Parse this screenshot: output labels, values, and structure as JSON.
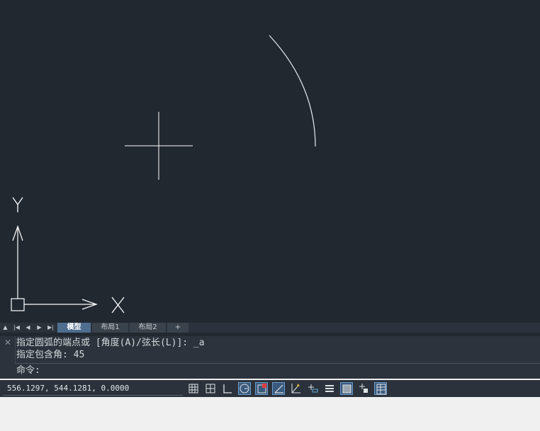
{
  "layout_tabs": {
    "nav_icons": [
      "triangle-up-icon",
      "first-page-icon",
      "prev-icon",
      "next-icon",
      "last-page-icon"
    ],
    "tabs": [
      {
        "label": "模型",
        "active": true
      },
      {
        "label": "布局1",
        "active": false
      },
      {
        "label": "布局2",
        "active": false
      }
    ],
    "add_label": "+"
  },
  "ucs": {
    "x_label": "X",
    "y_label": "Y"
  },
  "command_line": {
    "history": [
      "指定圆弧的端点或 [角度(A)/弦长(L)]: _a",
      "指定包含角: 45"
    ],
    "prompt": "命令:",
    "close_icon": "close-icon"
  },
  "status": {
    "coordinates": "556.1297, 544.1281, 0.0000",
    "toggles": [
      {
        "name": "snap-grid-icon",
        "on": false
      },
      {
        "name": "grid-display-icon",
        "on": false
      },
      {
        "name": "ortho-icon",
        "on": false
      },
      {
        "name": "polar-tracking-icon",
        "on": true
      },
      {
        "name": "object-snap-icon",
        "on": true
      },
      {
        "name": "object-snap-tracking-icon",
        "on": true
      },
      {
        "name": "dynamic-ucs-icon",
        "on": false
      },
      {
        "name": "dynamic-input-icon",
        "on": false
      },
      {
        "name": "lineweight-icon",
        "on": false
      },
      {
        "name": "transparency-icon",
        "on": true
      },
      {
        "name": "selection-cycling-icon",
        "on": false
      },
      {
        "name": "quick-properties-icon",
        "on": true
      }
    ]
  },
  "colors": {
    "canvas": "#212830",
    "active_tab": "#4f6d8f",
    "toggle_on": "#3a5a7d"
  }
}
